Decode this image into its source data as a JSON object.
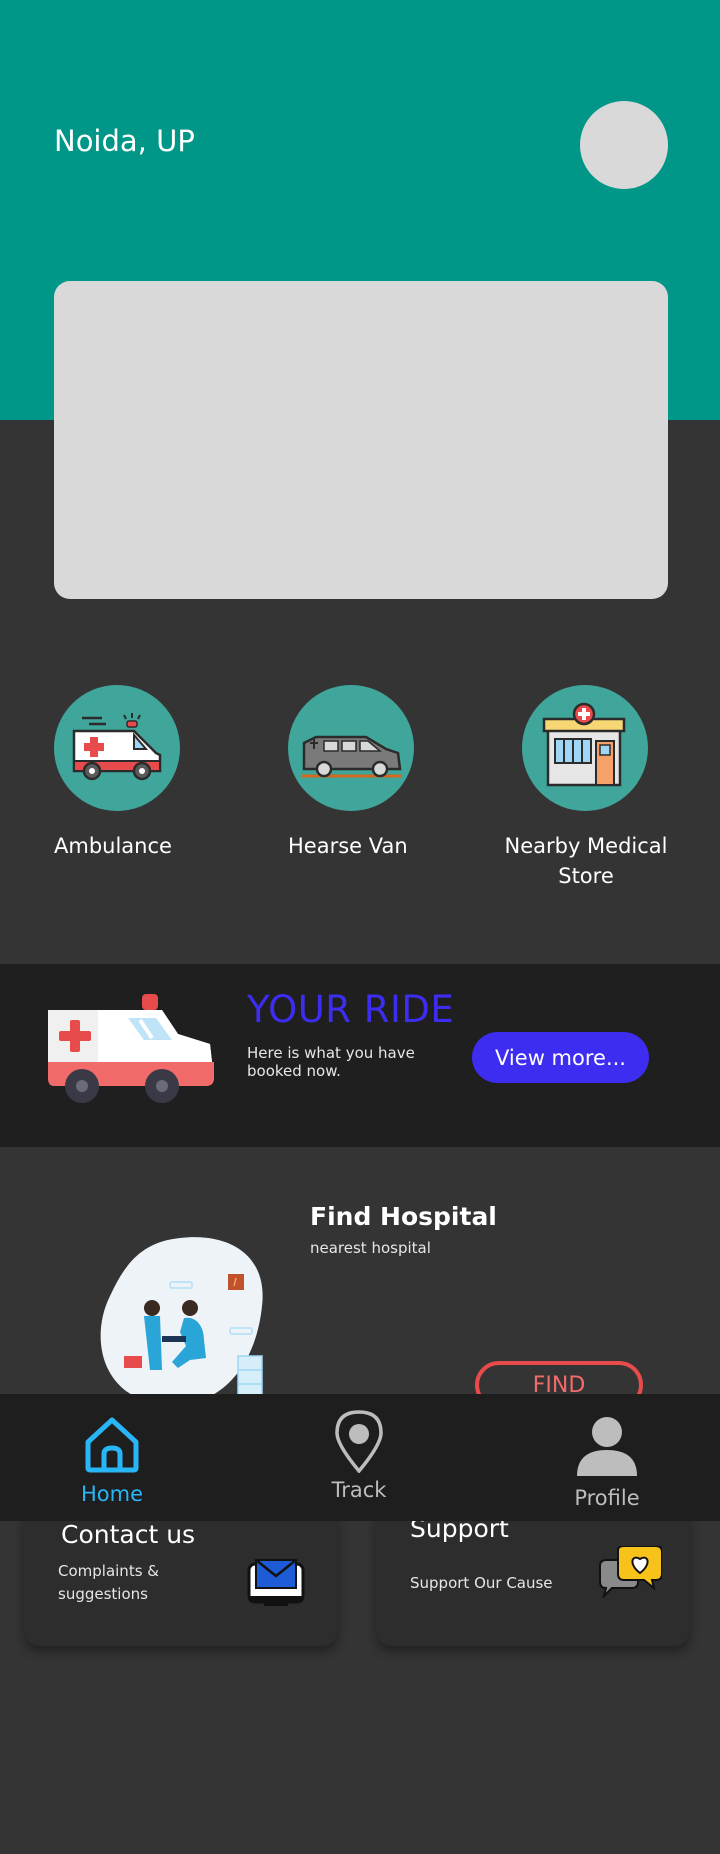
{
  "header": {
    "location": "Noida, UP"
  },
  "services": [
    {
      "label": "Ambulance",
      "icon": "ambulance-icon"
    },
    {
      "label": "Hearse Van",
      "icon": "hearse-van-icon"
    },
    {
      "label_line1": "Nearby Medical",
      "label_line2": "Store",
      "icon": "medical-store-icon"
    }
  ],
  "ride": {
    "title": "YOUR RIDE",
    "subtitle": "Here is what you have booked now.",
    "button_label": "View more..."
  },
  "find_hospital": {
    "title": "Find Hospital",
    "subtitle": "nearest hospital",
    "button_label": "FIND"
  },
  "cards": [
    {
      "title": "Contact us",
      "subtitle_line1": "Complaints &",
      "subtitle_line2": "suggestions",
      "icon": "mail-icon"
    },
    {
      "title": "Support",
      "subtitle": "Support Our Cause",
      "icon": "chat-heart-icon"
    }
  ],
  "nav": {
    "items": [
      {
        "label": "Home",
        "active": true,
        "icon": "home-icon"
      },
      {
        "label": "Track",
        "active": false,
        "icon": "location-pin-icon"
      },
      {
        "label": "Profile",
        "active": false,
        "icon": "person-icon"
      }
    ]
  },
  "colors": {
    "header_teal": "#009688",
    "accent_blue": "#3d2df0",
    "find_red": "#e84b4b",
    "nav_active": "#29b6f6",
    "nav_inactive": "#bdbdbd"
  }
}
